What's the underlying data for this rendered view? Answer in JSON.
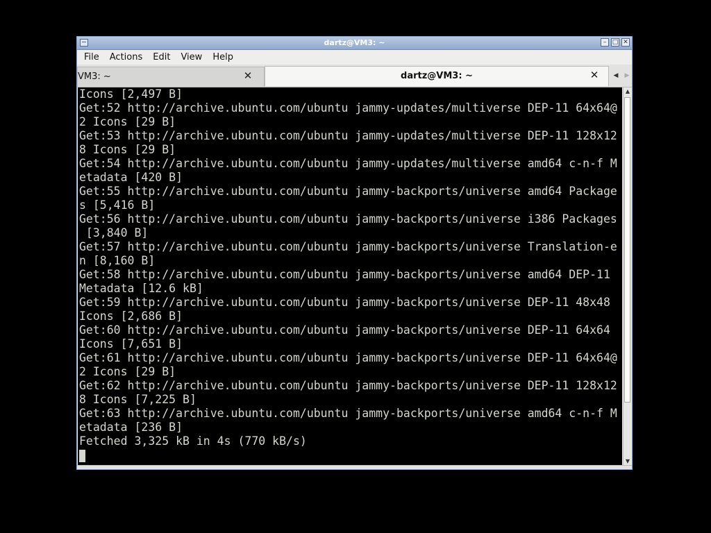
{
  "window": {
    "title": "dartz@VM3: ~",
    "icons": [
      "terminal-app-icon",
      "minimize-icon",
      "maximize-icon",
      "close-icon"
    ]
  },
  "menubar": {
    "items": [
      "File",
      "Actions",
      "Edit",
      "View",
      "Help"
    ]
  },
  "tabs": [
    {
      "label": "VM3: ~",
      "active": false
    },
    {
      "label": "dartz@VM3: ~",
      "active": true
    }
  ],
  "terminal": {
    "lines": [
      "Icons [2,497 B]",
      "Get:52 http://archive.ubuntu.com/ubuntu jammy-updates/multiverse DEP-11 64x64@",
      "2 Icons [29 B]",
      "Get:53 http://archive.ubuntu.com/ubuntu jammy-updates/multiverse DEP-11 128x12",
      "8 Icons [29 B]",
      "Get:54 http://archive.ubuntu.com/ubuntu jammy-updates/multiverse amd64 c-n-f M",
      "etadata [420 B]",
      "Get:55 http://archive.ubuntu.com/ubuntu jammy-backports/universe amd64 Package",
      "s [5,416 B]",
      "Get:56 http://archive.ubuntu.com/ubuntu jammy-backports/universe i386 Packages",
      " [3,840 B]",
      "Get:57 http://archive.ubuntu.com/ubuntu jammy-backports/universe Translation-e",
      "n [8,160 B]",
      "Get:58 http://archive.ubuntu.com/ubuntu jammy-backports/universe amd64 DEP-11",
      "Metadata [12.6 kB]",
      "Get:59 http://archive.ubuntu.com/ubuntu jammy-backports/universe DEP-11 48x48",
      "Icons [2,686 B]",
      "Get:60 http://archive.ubuntu.com/ubuntu jammy-backports/universe DEP-11 64x64",
      "Icons [7,651 B]",
      "Get:61 http://archive.ubuntu.com/ubuntu jammy-backports/universe DEP-11 64x64@",
      "2 Icons [29 B]",
      "Get:62 http://archive.ubuntu.com/ubuntu jammy-backports/universe DEP-11 128x12",
      "8 Icons [7,225 B]",
      "Get:63 http://archive.ubuntu.com/ubuntu jammy-backports/universe amd64 c-n-f M",
      "etadata [236 B]",
      "Fetched 3,325 kB in 4s (770 kB/s)"
    ],
    "prompt": ""
  },
  "colors": {
    "terminal_bg": "#000000",
    "terminal_fg": "#d3d7cf",
    "titlebar": "#a9bfdd"
  }
}
